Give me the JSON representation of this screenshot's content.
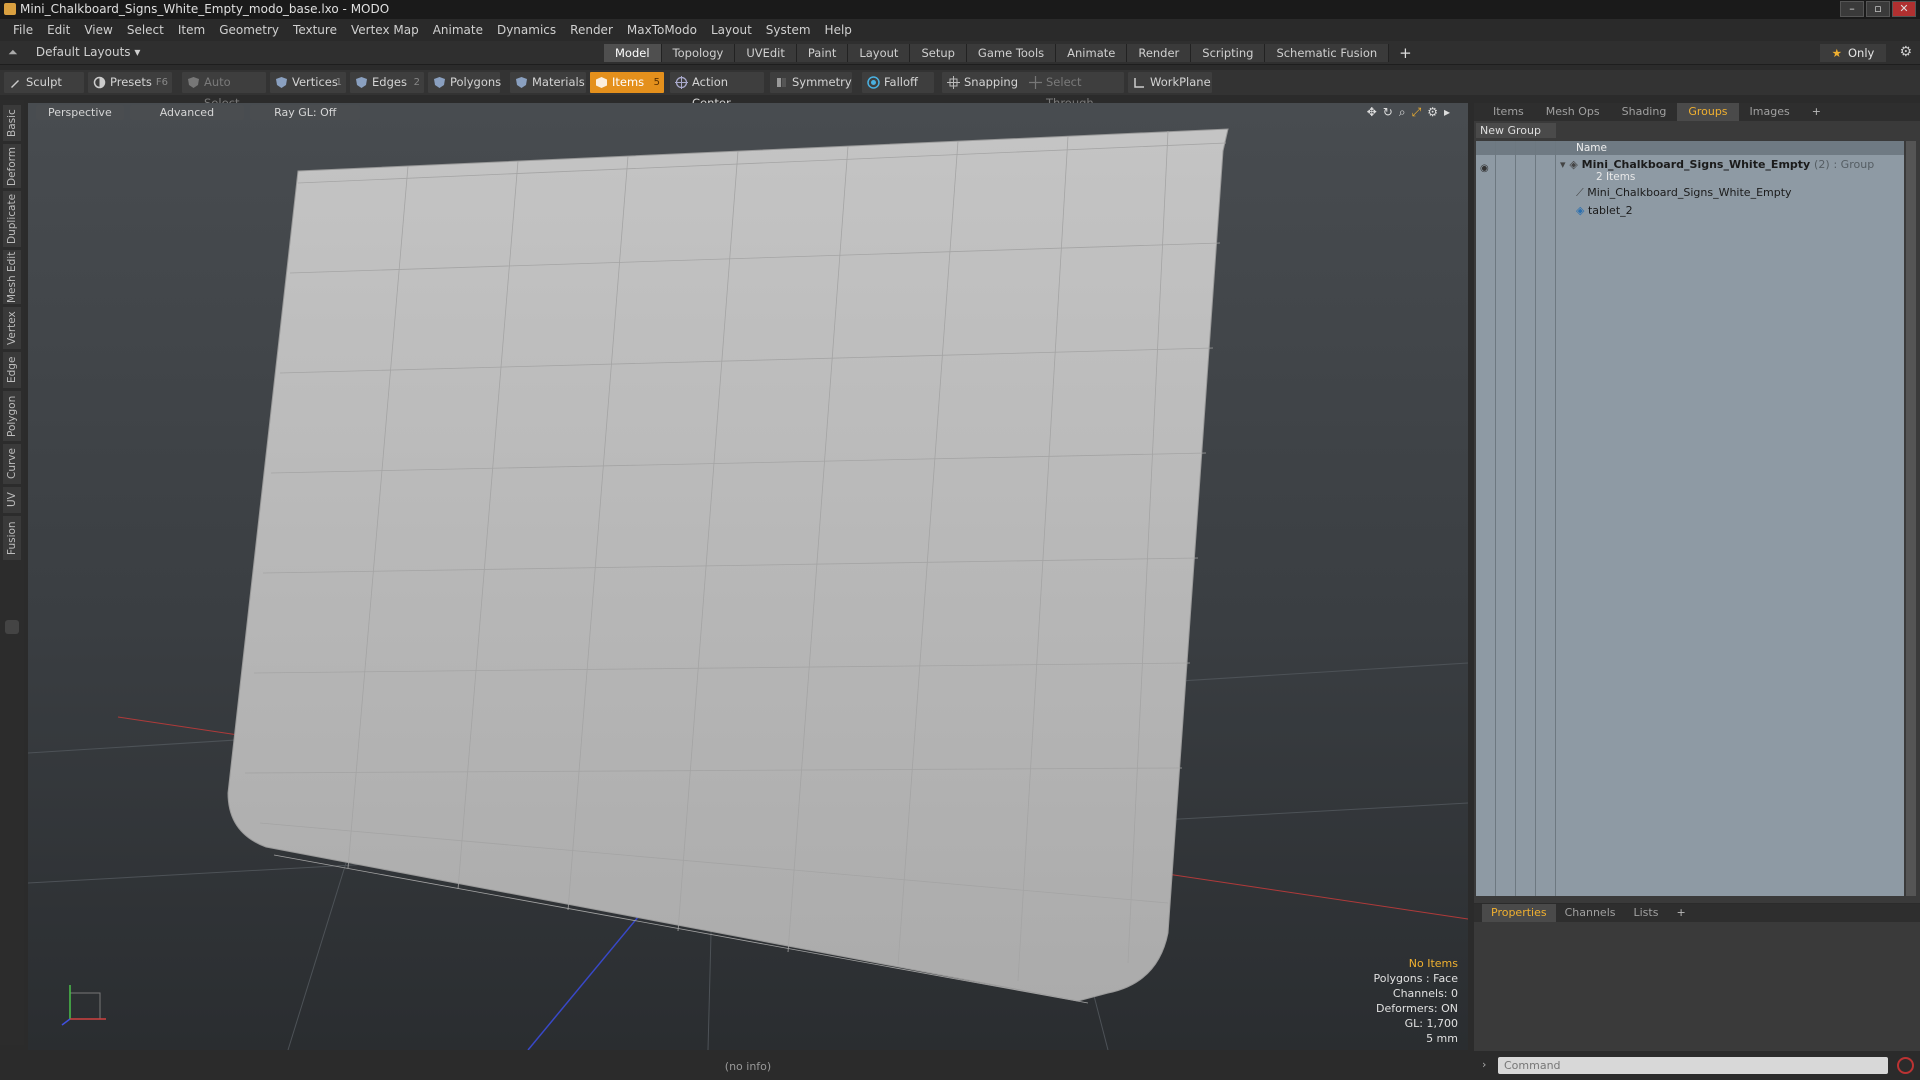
{
  "window": {
    "title": "Mini_Chalkboard_Signs_White_Empty_modo_base.lxo - MODO"
  },
  "menu": [
    "File",
    "Edit",
    "View",
    "Select",
    "Item",
    "Geometry",
    "Texture",
    "Vertex Map",
    "Animate",
    "Dynamics",
    "Render",
    "MaxToModo",
    "Layout",
    "System",
    "Help"
  ],
  "layout_bar": {
    "layout_dropdown": "Default Layouts ▾",
    "tabs": [
      "Model",
      "Topology",
      "UVEdit",
      "Paint",
      "Layout",
      "Setup",
      "Game Tools",
      "Animate",
      "Render",
      "Scripting",
      "Schematic Fusion"
    ],
    "active_tab": "Model",
    "only_label": "Only"
  },
  "toolbar": {
    "sculpt": "Sculpt",
    "presets": "Presets",
    "presets_key": "F6",
    "auto_select": "Auto Select",
    "vertices": "Vertices",
    "vertices_key": "1",
    "edges": "Edges",
    "edges_key": "2",
    "polygons": "Polygons",
    "materials": "Materials",
    "items": "Items",
    "items_key": "5",
    "action_center": "Action Center",
    "symmetry": "Symmetry",
    "falloff": "Falloff",
    "snapping": "Snapping",
    "select_through": "Select Through",
    "workplane": "WorkPlane"
  },
  "left_tabs": [
    "Basic",
    "Deform",
    "Duplicate",
    "Mesh Edit",
    "Vertex",
    "Edge",
    "Polygon",
    "Curve",
    "UV",
    "Fusion"
  ],
  "viewport": {
    "view": "Perspective",
    "shading": "Advanced",
    "raygl": "Ray GL: Off",
    "info": {
      "selection": "No Items",
      "polygons": "Polygons : Face",
      "channels": "Channels: 0",
      "deformers": "Deformers: ON",
      "gl": "GL: 1,700",
      "scale": "5 mm"
    }
  },
  "status": "(no info)",
  "right_panel": {
    "tabs": [
      "Items",
      "Mesh Ops",
      "Shading",
      "Groups",
      "Images"
    ],
    "active_tab": "Groups",
    "new_group": "New Group",
    "name_header": "Name",
    "group": {
      "name": "Mini_Chalkboard_Signs_White_Empty",
      "count": "(2)",
      "type": ": Group",
      "sub": "2 Items"
    },
    "children": [
      "Mini_Chalkboard_Signs_White_Empty",
      "tablet_2"
    ]
  },
  "props_panel": {
    "tabs": [
      "Properties",
      "Channels",
      "Lists"
    ],
    "active_tab": "Properties"
  },
  "command": {
    "placeholder": "Command"
  },
  "colors": {
    "accent": "#e4901c",
    "active_text": "#f0b030"
  }
}
